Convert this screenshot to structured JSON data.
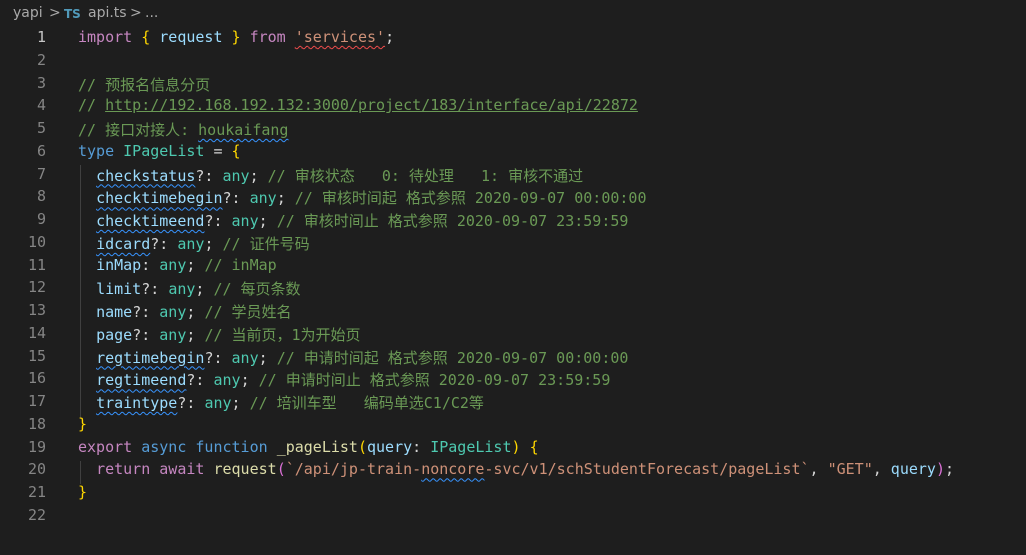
{
  "breadcrumb": {
    "folder": "yapi",
    "sep": ">",
    "file_badge": "TS",
    "file": "api.ts",
    "ellipsis": "..."
  },
  "editor": {
    "active_line": 1,
    "lines": [
      {
        "n": "1",
        "t": [
          [
            "kw2",
            "import"
          ],
          [
            "pl",
            " "
          ],
          [
            "br",
            "{"
          ],
          [
            "pl",
            " "
          ],
          [
            "var",
            "request"
          ],
          [
            "pl",
            " "
          ],
          [
            "br",
            "}"
          ],
          [
            "pl",
            " "
          ],
          [
            "kw2",
            "from"
          ],
          [
            "pl",
            " "
          ],
          [
            "str squig-red",
            "'services'"
          ],
          [
            "pl",
            ";"
          ]
        ]
      },
      {
        "n": "2",
        "t": []
      },
      {
        "n": "3",
        "t": [
          [
            "cm",
            "// 预报名信息分页"
          ]
        ]
      },
      {
        "n": "4",
        "t": [
          [
            "cm",
            "// "
          ],
          [
            "cm link",
            "http://192.168.192.132:3000/project/183/interface/api/22872"
          ]
        ]
      },
      {
        "n": "5",
        "t": [
          [
            "cm",
            "// 接口对接人: "
          ],
          [
            "cm squig",
            "houkaifang"
          ]
        ]
      },
      {
        "n": "6",
        "t": [
          [
            "kw",
            "type"
          ],
          [
            "pl",
            " "
          ],
          [
            "ty",
            "IPageList"
          ],
          [
            "pl",
            " = "
          ],
          [
            "br",
            "{"
          ]
        ]
      },
      {
        "n": "7",
        "t": [
          [
            "pl",
            "  "
          ],
          [
            "var squig",
            "checkstatus"
          ],
          [
            "pl",
            "?: "
          ],
          [
            "ty",
            "any"
          ],
          [
            "pl",
            "; "
          ],
          [
            "cm",
            "// 审核状态   0: 待处理   1: 审核不通过"
          ]
        ]
      },
      {
        "n": "8",
        "t": [
          [
            "pl",
            "  "
          ],
          [
            "var squig",
            "checktimebegin"
          ],
          [
            "pl",
            "?: "
          ],
          [
            "ty",
            "any"
          ],
          [
            "pl",
            "; "
          ],
          [
            "cm",
            "// 审核时间起 格式参照 2020-09-07 00:00:00"
          ]
        ]
      },
      {
        "n": "9",
        "t": [
          [
            "pl",
            "  "
          ],
          [
            "var squig",
            "checktimeend"
          ],
          [
            "pl",
            "?: "
          ],
          [
            "ty",
            "any"
          ],
          [
            "pl",
            "; "
          ],
          [
            "cm",
            "// 审核时间止 格式参照 2020-09-07 23:59:59"
          ]
        ]
      },
      {
        "n": "10",
        "t": [
          [
            "pl",
            "  "
          ],
          [
            "var squig",
            "idcard"
          ],
          [
            "pl",
            "?: "
          ],
          [
            "ty",
            "any"
          ],
          [
            "pl",
            "; "
          ],
          [
            "cm",
            "// 证件号码"
          ]
        ]
      },
      {
        "n": "11",
        "t": [
          [
            "pl",
            "  "
          ],
          [
            "var",
            "inMap"
          ],
          [
            "pl",
            ": "
          ],
          [
            "ty",
            "any"
          ],
          [
            "pl",
            "; "
          ],
          [
            "cm",
            "// inMap"
          ]
        ]
      },
      {
        "n": "12",
        "t": [
          [
            "pl",
            "  "
          ],
          [
            "var",
            "limit"
          ],
          [
            "pl",
            "?: "
          ],
          [
            "ty",
            "any"
          ],
          [
            "pl",
            "; "
          ],
          [
            "cm",
            "// 每页条数"
          ]
        ]
      },
      {
        "n": "13",
        "t": [
          [
            "pl",
            "  "
          ],
          [
            "var",
            "name"
          ],
          [
            "pl",
            "?: "
          ],
          [
            "ty",
            "any"
          ],
          [
            "pl",
            "; "
          ],
          [
            "cm",
            "// 学员姓名"
          ]
        ]
      },
      {
        "n": "14",
        "t": [
          [
            "pl",
            "  "
          ],
          [
            "var",
            "page"
          ],
          [
            "pl",
            "?: "
          ],
          [
            "ty",
            "any"
          ],
          [
            "pl",
            "; "
          ],
          [
            "cm",
            "// 当前页，1为开始页"
          ]
        ]
      },
      {
        "n": "15",
        "t": [
          [
            "pl",
            "  "
          ],
          [
            "var squig",
            "regtimebegin"
          ],
          [
            "pl",
            "?: "
          ],
          [
            "ty",
            "any"
          ],
          [
            "pl",
            "; "
          ],
          [
            "cm",
            "// 申请时间起 格式参照 2020-09-07 00:00:00"
          ]
        ]
      },
      {
        "n": "16",
        "t": [
          [
            "pl",
            "  "
          ],
          [
            "var squig",
            "regtimeend"
          ],
          [
            "pl",
            "?: "
          ],
          [
            "ty",
            "any"
          ],
          [
            "pl",
            "; "
          ],
          [
            "cm",
            "// 申请时间止 格式参照 2020-09-07 23:59:59"
          ]
        ]
      },
      {
        "n": "17",
        "t": [
          [
            "pl",
            "  "
          ],
          [
            "var squig",
            "traintype"
          ],
          [
            "pl",
            "?: "
          ],
          [
            "ty",
            "any"
          ],
          [
            "pl",
            "; "
          ],
          [
            "cm",
            "// 培训车型   编码单选C1/C2等"
          ]
        ]
      },
      {
        "n": "18",
        "t": [
          [
            "br",
            "}"
          ]
        ]
      },
      {
        "n": "19",
        "t": [
          [
            "kw2",
            "export"
          ],
          [
            "pl",
            " "
          ],
          [
            "kw",
            "async"
          ],
          [
            "pl",
            " "
          ],
          [
            "kw",
            "function"
          ],
          [
            "pl",
            " "
          ],
          [
            "fn",
            "_pageList"
          ],
          [
            "br",
            "("
          ],
          [
            "var",
            "query"
          ],
          [
            "pl",
            ": "
          ],
          [
            "ty",
            "IPageList"
          ],
          [
            "br",
            ")"
          ],
          [
            "pl",
            " "
          ],
          [
            "br",
            "{"
          ]
        ]
      },
      {
        "n": "20",
        "t": [
          [
            "pl",
            "  "
          ],
          [
            "kw2",
            "return"
          ],
          [
            "pl",
            " "
          ],
          [
            "kw2",
            "await"
          ],
          [
            "pl",
            " "
          ],
          [
            "fn",
            "request"
          ],
          [
            "br2",
            "("
          ],
          [
            "str",
            "`/api/jp-train-"
          ],
          [
            "str squig",
            "noncore"
          ],
          [
            "str",
            "-svc/v1/schStudentForecast/pageList`"
          ],
          [
            "pl",
            ", "
          ],
          [
            "str",
            "\"GET\""
          ],
          [
            "pl",
            ", "
          ],
          [
            "var",
            "query"
          ],
          [
            "br2",
            ")"
          ],
          [
            "pl",
            ";"
          ]
        ]
      },
      {
        "n": "21",
        "t": [
          [
            "br",
            "}"
          ]
        ]
      },
      {
        "n": "22",
        "t": []
      }
    ]
  }
}
